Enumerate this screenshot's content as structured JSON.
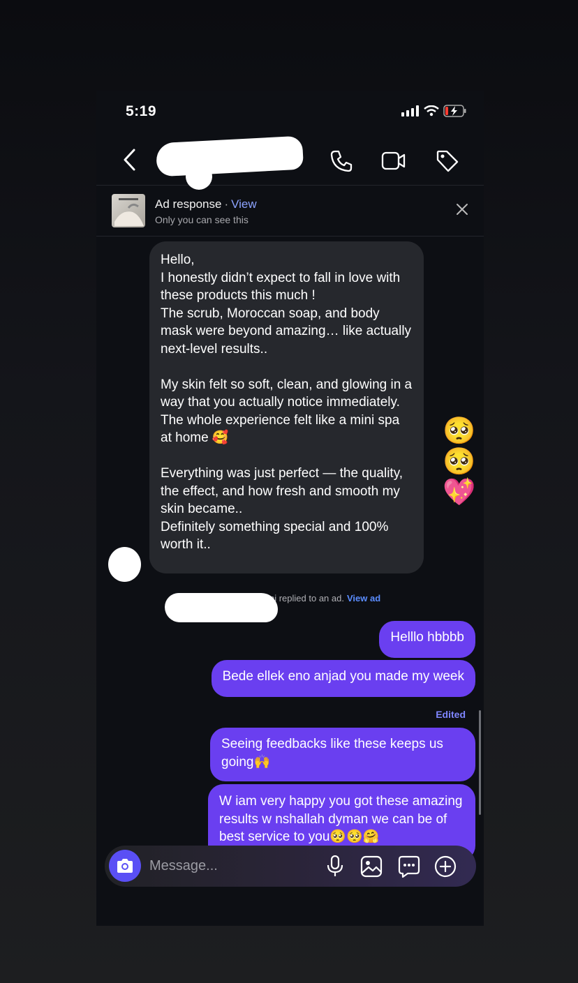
{
  "status_bar": {
    "time": "5:19"
  },
  "header": {
    "back_icon": "chevron-left-icon",
    "actions": [
      "phone-icon",
      "video-icon",
      "tag-icon"
    ]
  },
  "ad_banner": {
    "title": "Ad response",
    "separator": "·",
    "view_label": "View",
    "subtitle": "Only you can see this"
  },
  "messages": {
    "incoming": "Hello,\nI honestly didn’t expect to fall in love with these products this much !\nThe scrub, Moroccan soap, and body mask were beyond amazing… like actually next-level results..\n\nMy skin felt so soft, clean, and glowing in a way that you actually notice immediately. The whole experience felt like a mini spa at home 🥰\n\nEverything was just perfect — the quality, the effect, and how fresh and smooth my skin became..\nDefinitely something special and 100% worth it..",
    "reaction": "🥺🥺💖",
    "replied_note": "ni replied to an ad.",
    "view_ad": "View ad",
    "out_1": "Helllo hbbbb",
    "out_2": "Bede ellek eno anjad you made my week",
    "edited": "Edited",
    "out_3": "Seeing feedbacks like these keeps us going🙌",
    "out_4": "W iam very happy you got these amazing results w nshallah dyman we can be of best service to you🥺🥺🤗"
  },
  "composer": {
    "placeholder": "Message..."
  },
  "colors": {
    "accent": "#6a3ff0",
    "camera": "#5a4ff5",
    "link": "#5b8dff"
  }
}
